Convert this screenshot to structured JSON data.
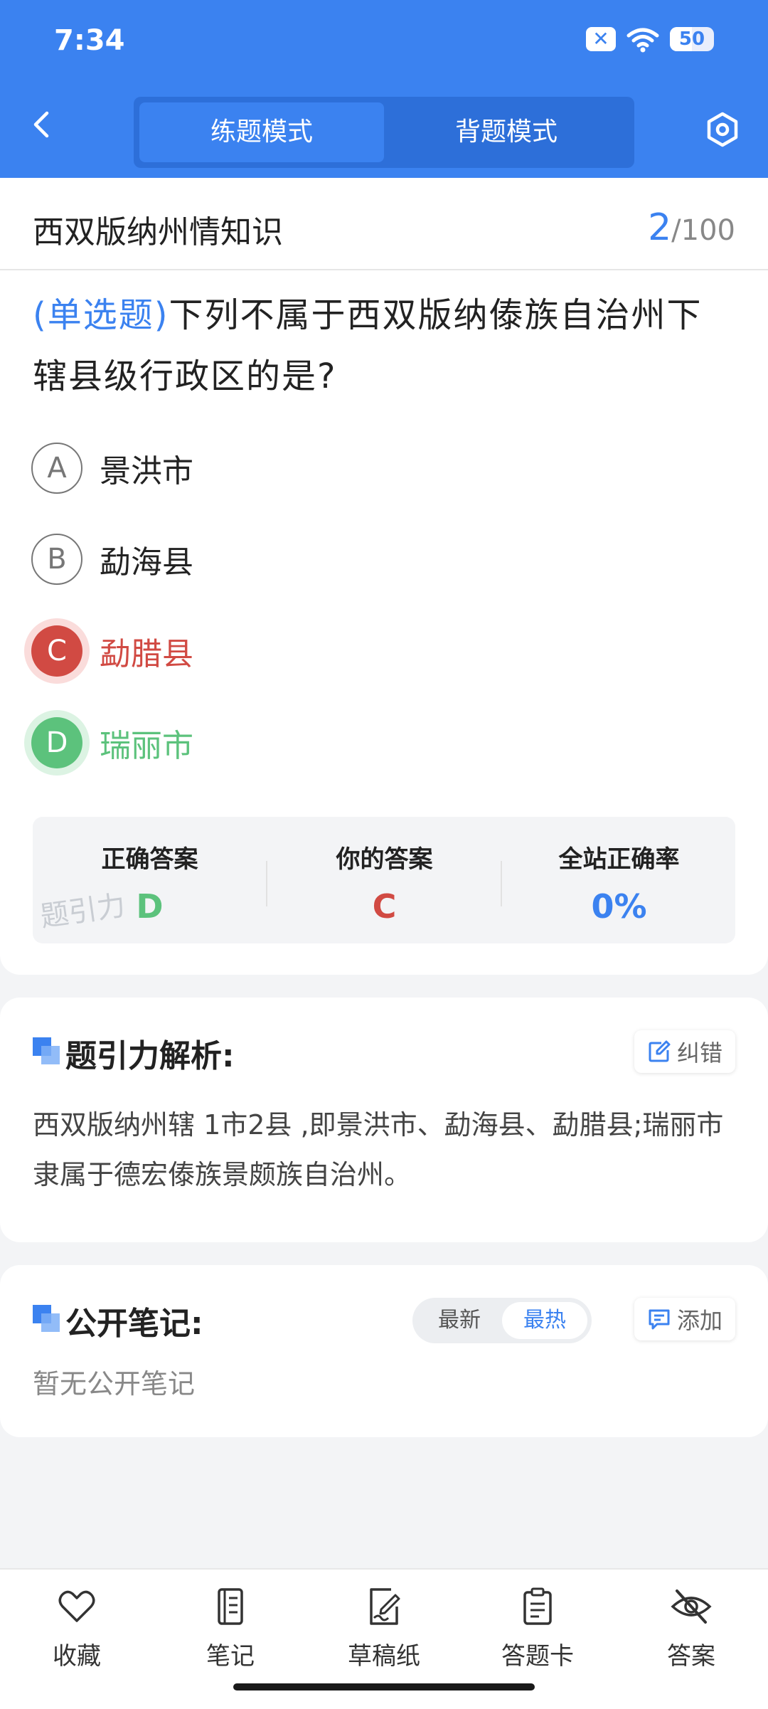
{
  "status": {
    "time": "7:34",
    "battery": "50",
    "battery_level": 0.5
  },
  "header": {
    "modes": [
      "练题模式",
      "背题模式"
    ],
    "active_mode": "练题模式"
  },
  "question": {
    "category": "西双版纳州情知识",
    "current": "2",
    "total": "/100",
    "type": "(单选题)",
    "text": "下列不属于西双版纳傣族自治州下辖县级行政区的是?",
    "options": [
      {
        "letter": "A",
        "label": "景洪市",
        "state": "normal"
      },
      {
        "letter": "B",
        "label": "勐海县",
        "state": "normal"
      },
      {
        "letter": "C",
        "label": "勐腊县",
        "state": "wrong"
      },
      {
        "letter": "D",
        "label": "瑞丽市",
        "state": "correct"
      }
    ]
  },
  "stats": {
    "correct_label": "正确答案",
    "correct_value": "D",
    "yours_label": "你的答案",
    "yours_value": "C",
    "rate_label": "全站正确率",
    "rate_value": "0%",
    "watermark": "题引力"
  },
  "analysis": {
    "title": "题引力解析:",
    "report_label": "纠错",
    "body": "西双版纳州辖 1市2县 ,即景洪市、勐海县、勐腊县;瑞丽市隶属于德宏傣族景颇族自治州。"
  },
  "notes": {
    "title": "公开笔记:",
    "sort_options": [
      "最新",
      "最热"
    ],
    "active_sort": "最热",
    "add_label": "添加",
    "empty_text": "暂无公开笔记"
  },
  "tabs": [
    {
      "label": "收藏",
      "icon": "heart-icon"
    },
    {
      "label": "笔记",
      "icon": "notebook-icon"
    },
    {
      "label": "草稿纸",
      "icon": "draft-pen-icon"
    },
    {
      "label": "答题卡",
      "icon": "clipboard-icon"
    },
    {
      "label": "答案",
      "icon": "eye-off-icon"
    }
  ],
  "colors": {
    "accent": "#3b82f0",
    "wrong": "#d14a43",
    "correct": "#5cc27c"
  }
}
